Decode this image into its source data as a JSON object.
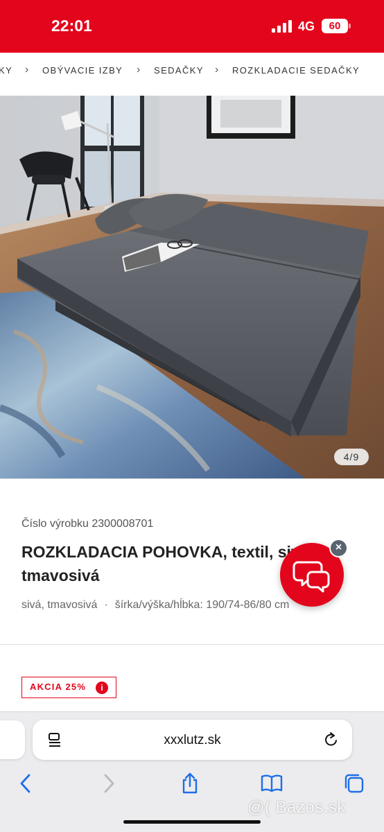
{
  "status_bar": {
    "time": "22:01",
    "network": "4G",
    "battery": "60"
  },
  "breadcrumb": {
    "items": [
      "KY",
      "OBÝVACIE IZBY",
      "SEDAČKY",
      "ROZKLADACIE SEDAČKY"
    ]
  },
  "gallery": {
    "counter": "4/9"
  },
  "product": {
    "sku_label": "Číslo výrobku 2300008701",
    "title_bold": "ROZKLADACIA",
    "title_rest": " POHOVKA, textil, sivá, tmavosivá",
    "color": "sivá, tmavosivá",
    "separator": "·",
    "dimensions": "šírka/výška/hĺbka: 190/74-86/80 cm",
    "badge": "AKCIA 25%",
    "badge_info": "i"
  },
  "chat": {
    "icon": "chat-bubbles-icon",
    "close": "×"
  },
  "browser": {
    "url": "xxxlutz.sk",
    "toolbar": [
      "back",
      "forward",
      "share",
      "bookmarks",
      "tabs"
    ]
  },
  "watermark": "@( Bazos.sk",
  "colors": {
    "brand_red": "#e3051b",
    "ios_blue": "#1e6ee8",
    "disabled_gray": "#b9b9be"
  }
}
